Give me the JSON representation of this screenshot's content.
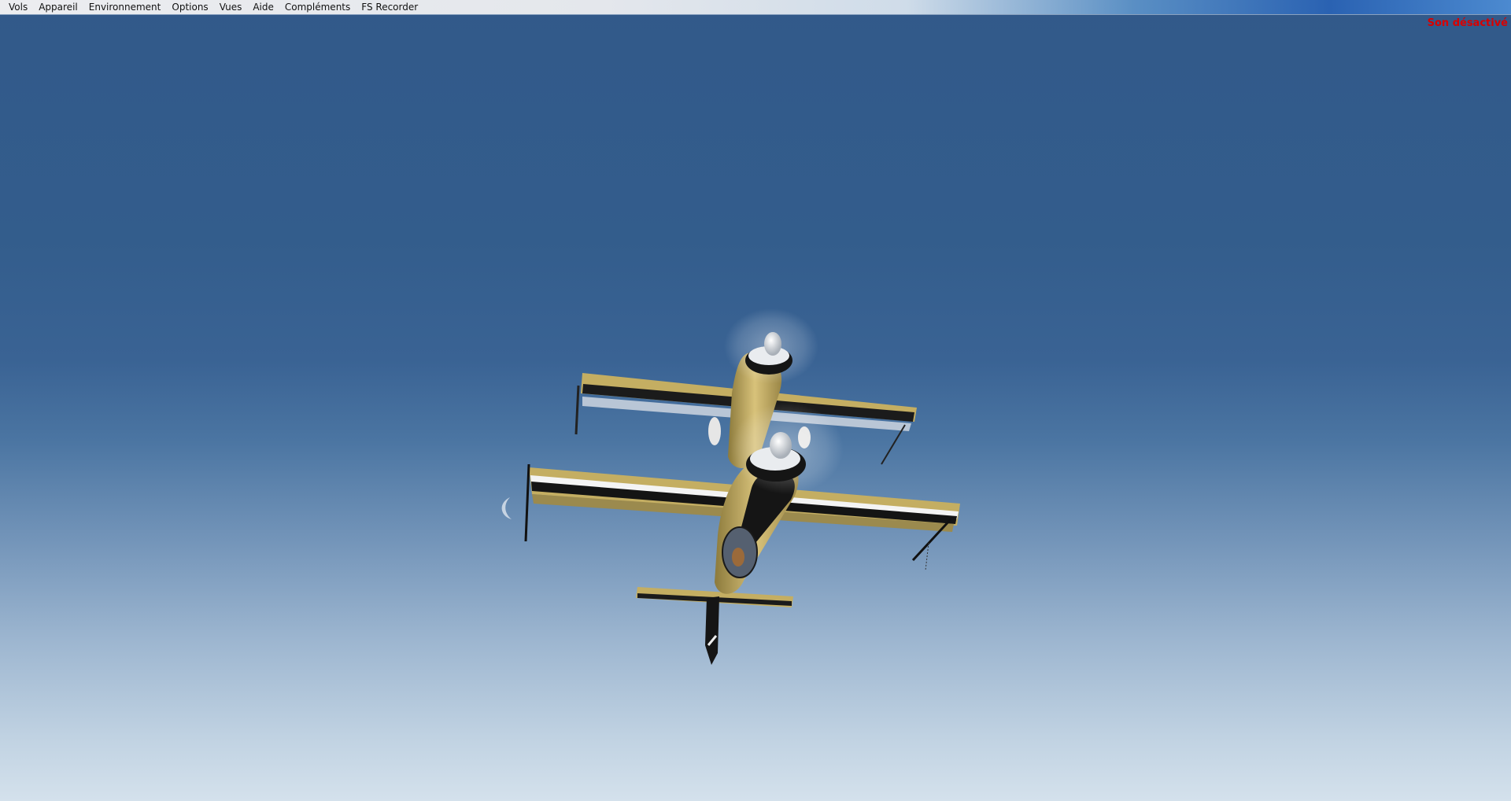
{
  "menu": {
    "items": [
      {
        "label": "Vols"
      },
      {
        "label": "Appareil"
      },
      {
        "label": "Environnement"
      },
      {
        "label": "Options"
      },
      {
        "label": "Vues"
      },
      {
        "label": "Aide"
      },
      {
        "label": "Compléments"
      },
      {
        "label": "FS Recorder"
      }
    ]
  },
  "status": {
    "sound": "Son désactivé"
  },
  "colors": {
    "status_text": "#d80000",
    "aircraft_yellow": "#c9b36a",
    "aircraft_black": "#161616"
  }
}
